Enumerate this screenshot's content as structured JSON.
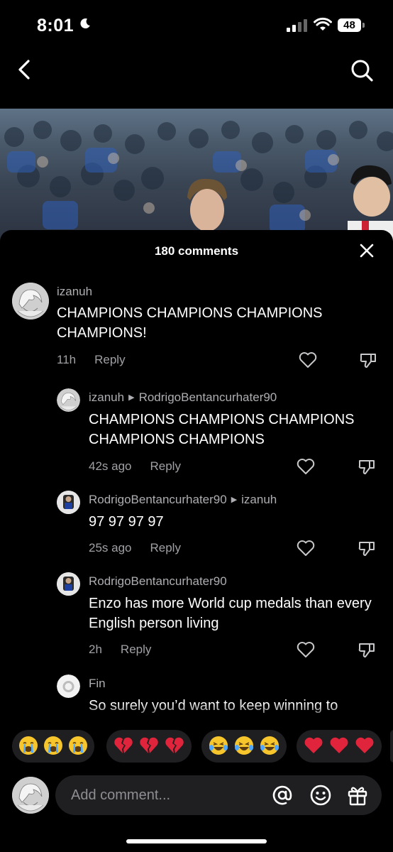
{
  "status": {
    "time": "8:01",
    "battery": "48"
  },
  "nav": {
    "back": "back-icon",
    "search": "search-icon"
  },
  "sheet": {
    "title": "180 comments"
  },
  "comments": [
    {
      "user": "izanuh",
      "reply_to": "",
      "text": "CHAMPIONS CHAMPIONS CHAMPIONS CHAMPIONS!",
      "time": "11h",
      "reply": "Reply"
    },
    {
      "user": "izanuh",
      "reply_to": "RodrigoBentancurhater90",
      "text": "CHAMPIONS CHAMPIONS CHAMPIONS CHAMPIONS CHAMPIONS",
      "time": "42s ago",
      "reply": "Reply"
    },
    {
      "user": "RodrigoBentancurhater90",
      "reply_to": "izanuh",
      "text": "97 97 97 97",
      "time": "25s ago",
      "reply": "Reply"
    },
    {
      "user": "RodrigoBentancurhater90",
      "reply_to": "",
      "text": "Enzo has more World cup medals than every English person living",
      "time": "2h",
      "reply": "Reply"
    },
    {
      "user": "Fin",
      "reply_to": "",
      "text": "So surely you’d want to keep winning to"
    }
  ],
  "emoji_groups": [
    [
      "😭",
      "😭",
      "😭"
    ],
    [
      "💔",
      "💔",
      "💔"
    ],
    [
      "😂",
      "😂",
      "😂"
    ],
    [
      "❤️",
      "❤️",
      "❤️"
    ]
  ],
  "composer": {
    "placeholder": "Add comment..."
  },
  "colors": {
    "background": "#000000",
    "pill": "#1f1f21",
    "muted_text": "#a0a0a5",
    "heart_red": "#e0243b"
  }
}
